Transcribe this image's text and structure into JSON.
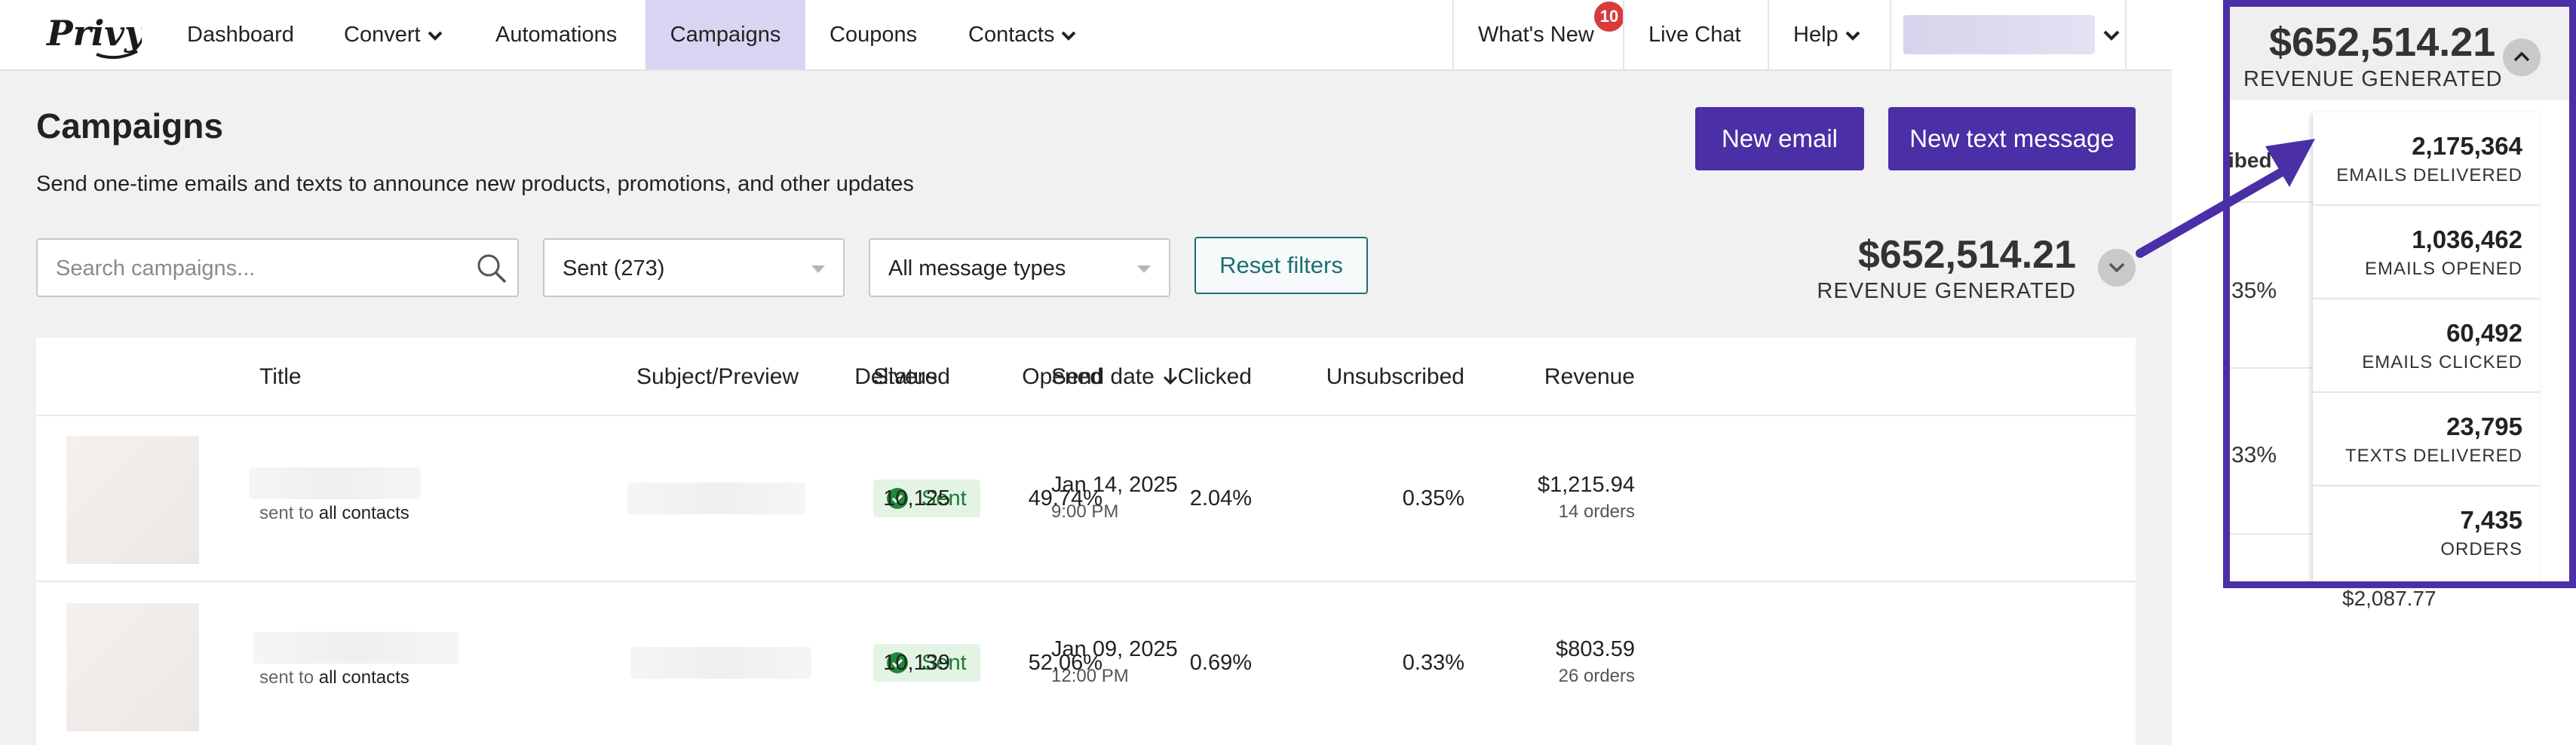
{
  "nav": {
    "logo": "Privy",
    "items": [
      {
        "label": "Dashboard"
      },
      {
        "label": "Convert"
      },
      {
        "label": "Automations"
      },
      {
        "label": "Campaigns"
      },
      {
        "label": "Coupons"
      },
      {
        "label": "Contacts"
      }
    ],
    "right": {
      "whats_new": "What's New",
      "whats_new_badge": "10",
      "live_chat": "Live Chat",
      "help": "Help"
    }
  },
  "page": {
    "title": "Campaigns",
    "subtitle": "Send one-time emails and texts to announce new products, promotions, and other updates",
    "new_email": "New email",
    "new_text": "New text message"
  },
  "filters": {
    "search_placeholder": "Search campaigns...",
    "status_value": "Sent (273)",
    "type_value": "All message types",
    "reset": "Reset filters"
  },
  "revenue": {
    "amount": "$652,514.21",
    "label": "REVENUE GENERATED"
  },
  "table": {
    "headers": {
      "title": "Title",
      "subject": "Subject/Preview",
      "status": "Status",
      "send_date": "Send date",
      "delivered": "Delivered",
      "opened": "Opened",
      "clicked": "Clicked",
      "unsubscribed": "Unsubscribed",
      "revenue": "Revenue"
    },
    "rows": [
      {
        "sent_to_prefix": "sent to",
        "sent_to": "all contacts",
        "status": "Sent",
        "date": "Jan 14, 2025",
        "time": "9:00 PM",
        "delivered": "10,125",
        "opened": "49.74%",
        "clicked": "2.04%",
        "unsubscribed": "0.35%",
        "revenue": "$1,215.94",
        "orders": "14 orders"
      },
      {
        "sent_to_prefix": "sent to",
        "sent_to": "all contacts",
        "status": "Sent",
        "date": "Jan 09, 2025",
        "time": "12:00 PM",
        "delivered": "10,139",
        "opened": "52.06%",
        "clicked": "0.69%",
        "unsubscribed": "0.33%",
        "revenue": "$803.59",
        "orders": "26 orders"
      }
    ]
  },
  "zoom": {
    "amount": "$652,514.21",
    "label": "REVENUE GENERATED",
    "fragments": {
      "header": "ibed",
      "row1": "35%",
      "row2": "33%",
      "below": "$2,087.77"
    },
    "stats": [
      {
        "value": "2,175,364",
        "label": "EMAILS DELIVERED"
      },
      {
        "value": "1,036,462",
        "label": "EMAILS OPENED"
      },
      {
        "value": "60,492",
        "label": "EMAILS CLICKED"
      },
      {
        "value": "23,795",
        "label": "TEXTS DELIVERED"
      },
      {
        "value": "7,435",
        "label": "ORDERS"
      }
    ]
  },
  "colors": {
    "brand": "#4a2fa6",
    "nav_active": "#d9d4f2",
    "status_green": "#1f8a3a",
    "reset_teal": "#1d6f74",
    "badge_red": "#d83b3b"
  }
}
